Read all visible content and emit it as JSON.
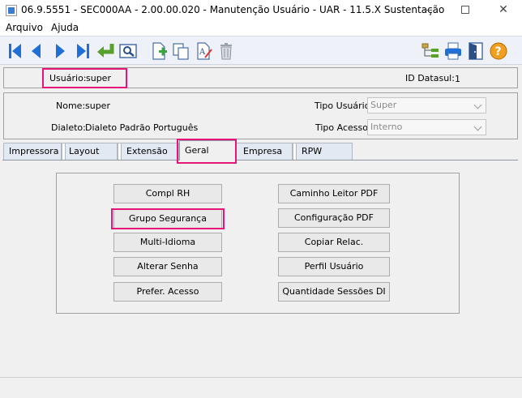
{
  "window": {
    "title": "06.9.5551 - SEC000AA - 2.00.00.020 - Manutenção Usuário - UAR - 11.5.X Sustentação"
  },
  "menu": [
    "Arquivo",
    "Ajuda"
  ],
  "toolbar": {
    "buttons": [
      "first-record-icon",
      "previous-record-icon",
      "next-record-icon",
      "last-record-icon",
      "goto-icon",
      "search-icon",
      "new-icon",
      "copy-icon",
      "edit-icon",
      "delete-icon",
      "tree-icon",
      "print-icon",
      "exit-icon",
      "help-icon"
    ]
  },
  "user": {
    "label": "Usuário:",
    "value": "super",
    "datasul_label": "ID Datasul:",
    "datasul_value": "1"
  },
  "info": {
    "nome_label": "Nome:",
    "nome_value": "super",
    "dialeto_label": "Dialeto:",
    "dialeto_value": "Dialeto Padrão Português",
    "tipo_usuario_label": "Tipo Usuário:",
    "tipo_usuario_value": "Super",
    "tipo_acesso_label": "Tipo Acesso:",
    "tipo_acesso_value": "Interno"
  },
  "tabs": [
    "Impressora",
    "Layout",
    "Extensão",
    "Geral",
    "Empresa",
    "RPW"
  ],
  "active_tab": "Geral",
  "buttons_left": [
    "Compl RH",
    "Grupo Segurança",
    "Multi-Idioma",
    "Alterar Senha",
    "Prefer. Acesso"
  ],
  "buttons_right": [
    "Caminho Leitor PDF",
    "Configuração PDF",
    "Copiar Relac.",
    "Perfil Usuário",
    "Quantidade Sessões DI"
  ],
  "colors": {
    "highlight": "#e5157a",
    "toolbar_blue": "#1f6fd6",
    "toolbar_green": "#5aa02c"
  }
}
